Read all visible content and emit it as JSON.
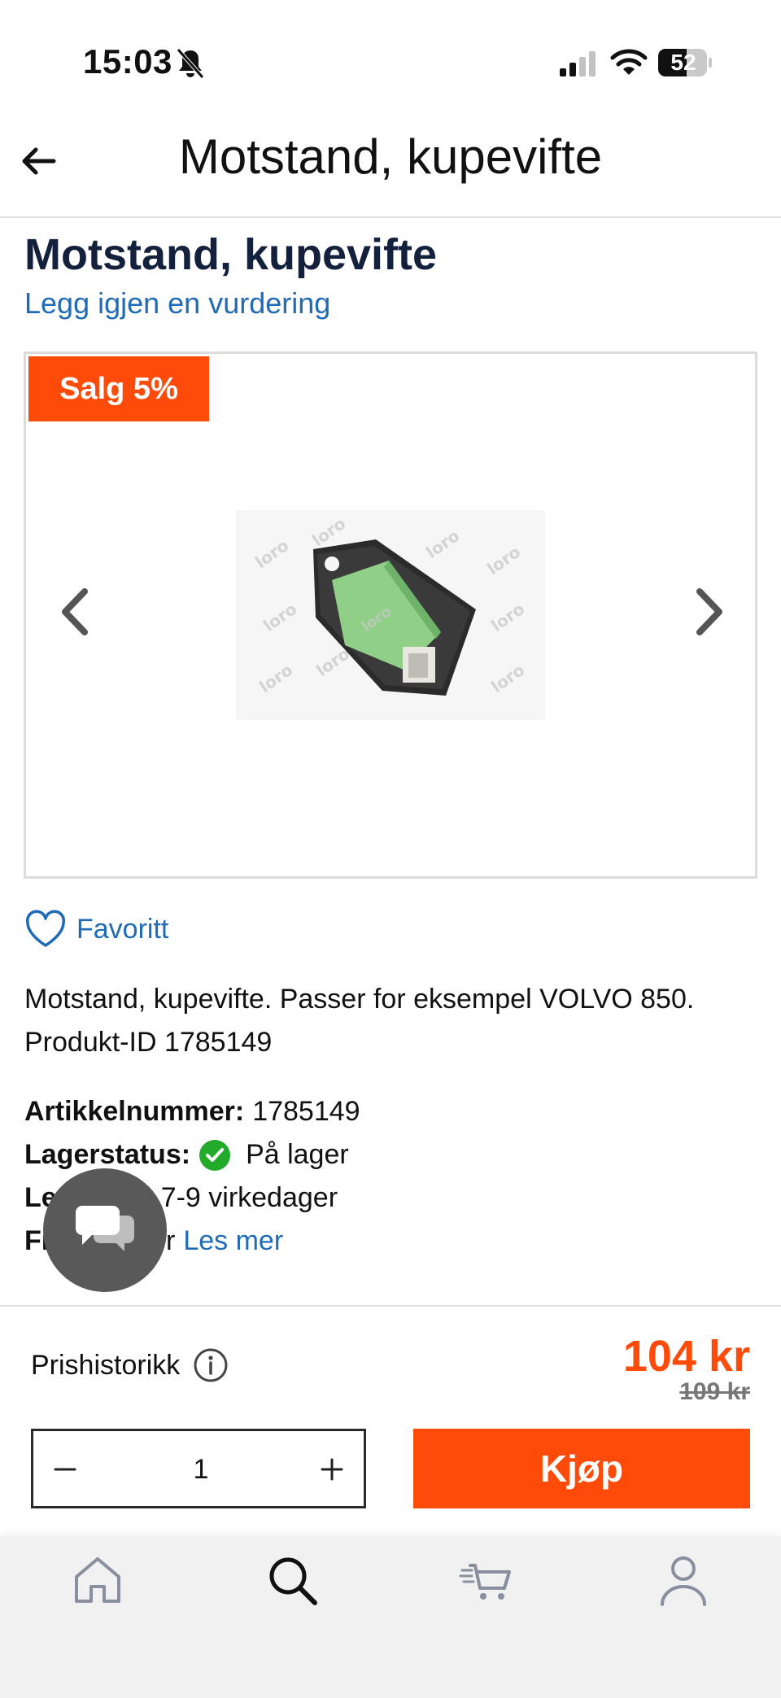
{
  "status_bar": {
    "time": "15:03",
    "battery": "52"
  },
  "header": {
    "title": "Motstand, kupevifte"
  },
  "product": {
    "title": "Motstand, kupevifte",
    "review_link": "Legg igjen en vurdering",
    "sale_badge": "Salg 5%",
    "image_alt": "Motstand, kupevifte",
    "image_watermark": "loro",
    "favorite_label": "Favoritt",
    "description_line1": "Motstand, kupevifte. Passer for eksempel VOLVO 850.",
    "description_line2": "Produkt-ID 1785149"
  },
  "specs": {
    "article_key": "Artikkelnummer:",
    "article_value": "1785149",
    "stock_key": "Lagerstatus:",
    "stock_value": "På lager",
    "delivery_key_visible": "Le",
    "delivery_value": "7-9 virkedager",
    "freight_key_visible": "Fr",
    "freight_value_visible": "r",
    "read_more": "Les mer"
  },
  "purchase": {
    "price_history_label": "Prishistorikk",
    "price_current": "104 kr",
    "price_old": "109 kr",
    "quantity": "1",
    "buy_label": "Kjøp"
  },
  "nav": {
    "items": [
      "home-icon",
      "search-icon",
      "cart-icon",
      "profile-icon"
    ],
    "active": "search-icon"
  },
  "colors": {
    "accent": "#ff4b0a",
    "link": "#1f6bb8",
    "title": "#14213d",
    "success": "#22aa2a",
    "chat": "#595959"
  }
}
